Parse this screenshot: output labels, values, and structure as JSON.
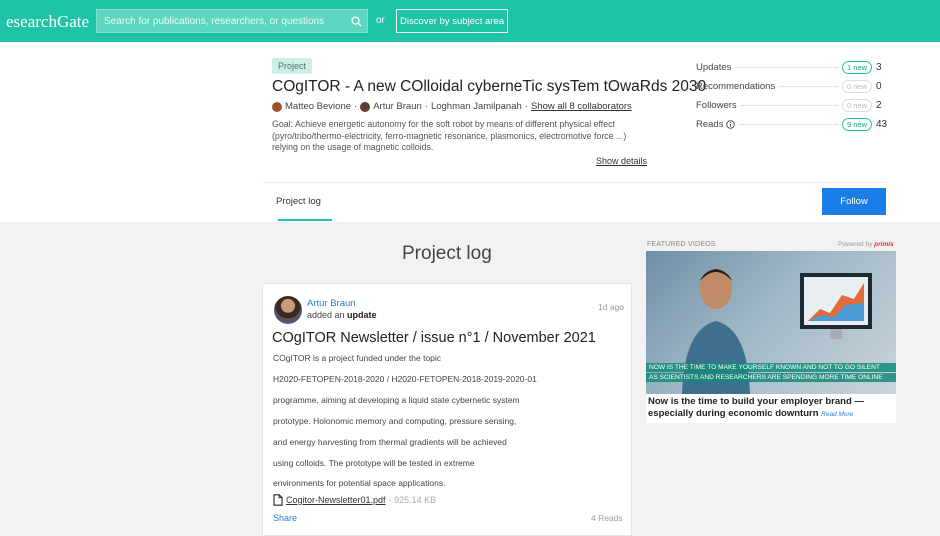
{
  "topbar": {
    "logo": "esearchGate",
    "search_placeholder": "Search for publications, researchers, or questions",
    "or": "or",
    "discover": "Discover by subject area"
  },
  "project": {
    "tag": "Project",
    "title": "COgITOR - A new COlloidal cyberneTic sysTem tOwaRds 2030",
    "authors": [
      "Matteo Bevione",
      "Artur Braun",
      "Loghman Jamilpanah"
    ],
    "show_all": "Show all 8 collaborators",
    "goal": "Goal: Achieve energetic autonomy for the soft robot by means of different physical effect (pyro/tribo/thermo-electricity, ferro-magnetic resonance, plasmonics, electromotive force ...) relying on the usage of magnetic colloids.",
    "show_details": "Show details"
  },
  "stats": [
    {
      "label": "Updates",
      "badge": "1 new",
      "count": "3",
      "badge_active": true
    },
    {
      "label": "Recommendations",
      "badge": "0 new",
      "count": "0",
      "badge_active": false
    },
    {
      "label": "Followers",
      "badge": "0 new",
      "count": "2",
      "badge_active": false
    },
    {
      "label": "Reads",
      "badge": "9 new",
      "count": "43",
      "badge_active": true
    }
  ],
  "tabs": {
    "project_log": "Project log",
    "follow": "Follow"
  },
  "log": {
    "heading": "Project log",
    "author": "Artur Braun",
    "action_prefix": "added an ",
    "action_strong": "update",
    "date": "1d ago",
    "title": "COgITOR Newsletter / issue n°1 / November 2021",
    "lines": [
      "COgITOR is a project funded under the topic",
      "H2020-FETOPEN-2018-2020 / H2020-FETOPEN-2018-2019-2020-01",
      "programme, aiming at developing a liquid state cybernetic system",
      "prototype. Holonomic memory and computing, pressure sensing,",
      "and energy harvesting from thermal gradients will be achieved",
      "using colloids. The prototype will be tested in extreme",
      "environments for potential space applications."
    ],
    "file_name": "Cogitor-Newsletter01.pdf",
    "file_size": "· 925.14 KB",
    "share": "Share",
    "reads": "4 Reads"
  },
  "featured": {
    "label": "FEATURED VIDEOS",
    "powered_prefix": "Powered by",
    "powered_brand": "primis",
    "banner1": "NOW IS THE TIME TO MAKE YOURSELF KNOWN AND NOT TO GO SILENT",
    "banner2": "AS SCIENTISTS AND RESEARCHERS ARE SPENDING MORE TIME ONLINE",
    "caption": "Now is the time to build your employer brand — especially during economic downturn",
    "read_more": "Read More"
  },
  "colors": {
    "brand": "#1fc3a6",
    "follow": "#1a7ee6",
    "link": "#2a7fd4"
  }
}
